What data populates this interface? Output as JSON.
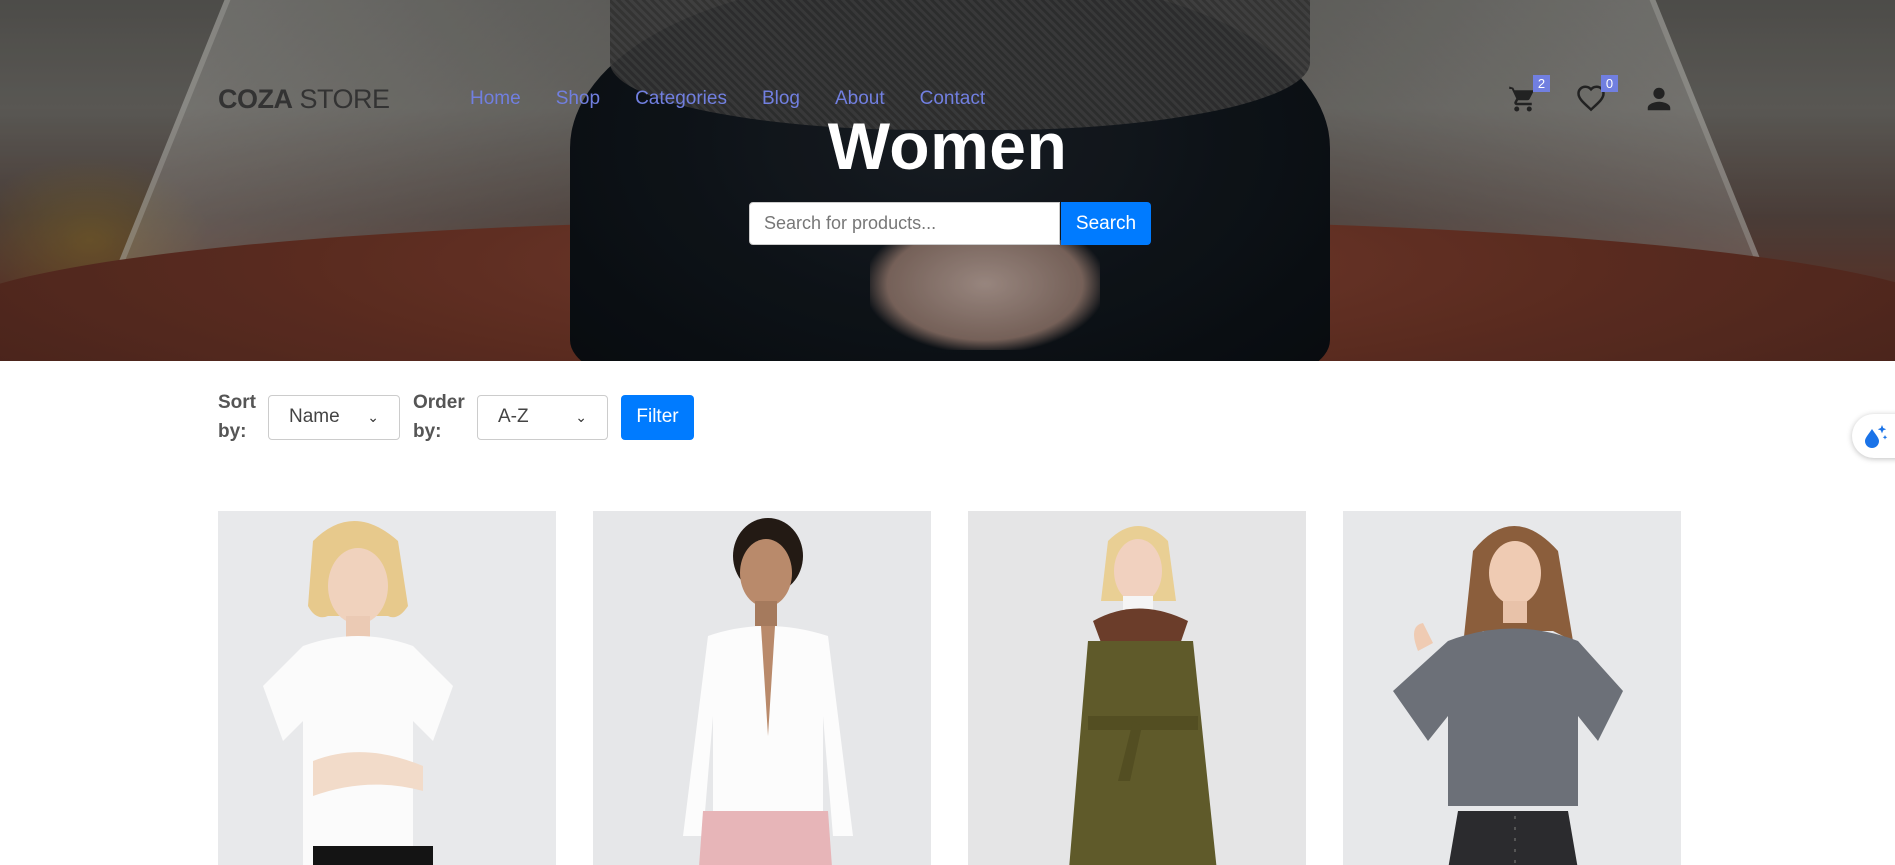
{
  "header": {
    "logo_bold": "COZA",
    "logo_rest": " STORE",
    "nav": [
      "Home",
      "Shop",
      "Categories",
      "Blog",
      "About",
      "Contact"
    ],
    "cart_count": "2",
    "wishlist_count": "0",
    "icons": [
      "cart-icon",
      "heart-icon",
      "user-icon"
    ]
  },
  "hero": {
    "title": "Women",
    "search_placeholder": "Search for products...",
    "search_button": "Search"
  },
  "filter": {
    "sort_label": "Sort by:",
    "sort_value": "Name",
    "order_label": "Order by:",
    "order_value": "A-Z",
    "filter_button": "Filter"
  },
  "colors": {
    "accent": "#717fe0",
    "button": "#007bff"
  },
  "products": [
    {
      "image": "woman-white-tshirt"
    },
    {
      "image": "woman-white-shirt-pink-pants"
    },
    {
      "image": "woman-olive-coat-fur-collar"
    },
    {
      "image": "woman-grey-denim-shirt"
    }
  ]
}
